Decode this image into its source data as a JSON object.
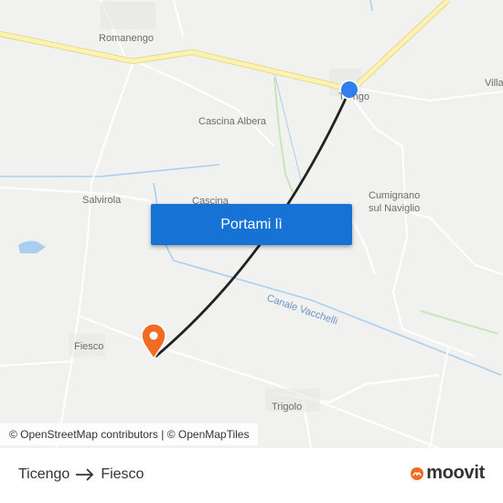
{
  "map": {
    "places": {
      "romanengo": "Romanengo",
      "cascina_albera": "Cascina Albera",
      "salvirola": "Salvirola",
      "cascina": "Cascina",
      "cumignano": "Cumignano",
      "sul_naviglio": "sul Naviglio",
      "fiesco": "Fiesco",
      "trigolo": "Trigolo",
      "ticengo_partial": "T   ngo",
      "villa_partial": "Villa"
    },
    "canal_label": "Canale Vacchelli",
    "colors": {
      "land": "#f1f1f0",
      "major_road": "#fbf2b4",
      "minor_road": "#ffffff",
      "water": "#a9cff0",
      "route_line": "#222222",
      "origin_marker": "#2f7ff0",
      "destination_marker": "#f26b22"
    },
    "origin_marker": "blue-dot",
    "destination_marker": "orange-pin"
  },
  "cta": {
    "label": "Portami lì"
  },
  "attribution": "© OpenStreetMap contributors | © OpenMapTiles",
  "route": {
    "from": "Ticengo",
    "to": "Fiesco"
  },
  "brand": {
    "name": "moovit",
    "accent": "#f26b22"
  }
}
